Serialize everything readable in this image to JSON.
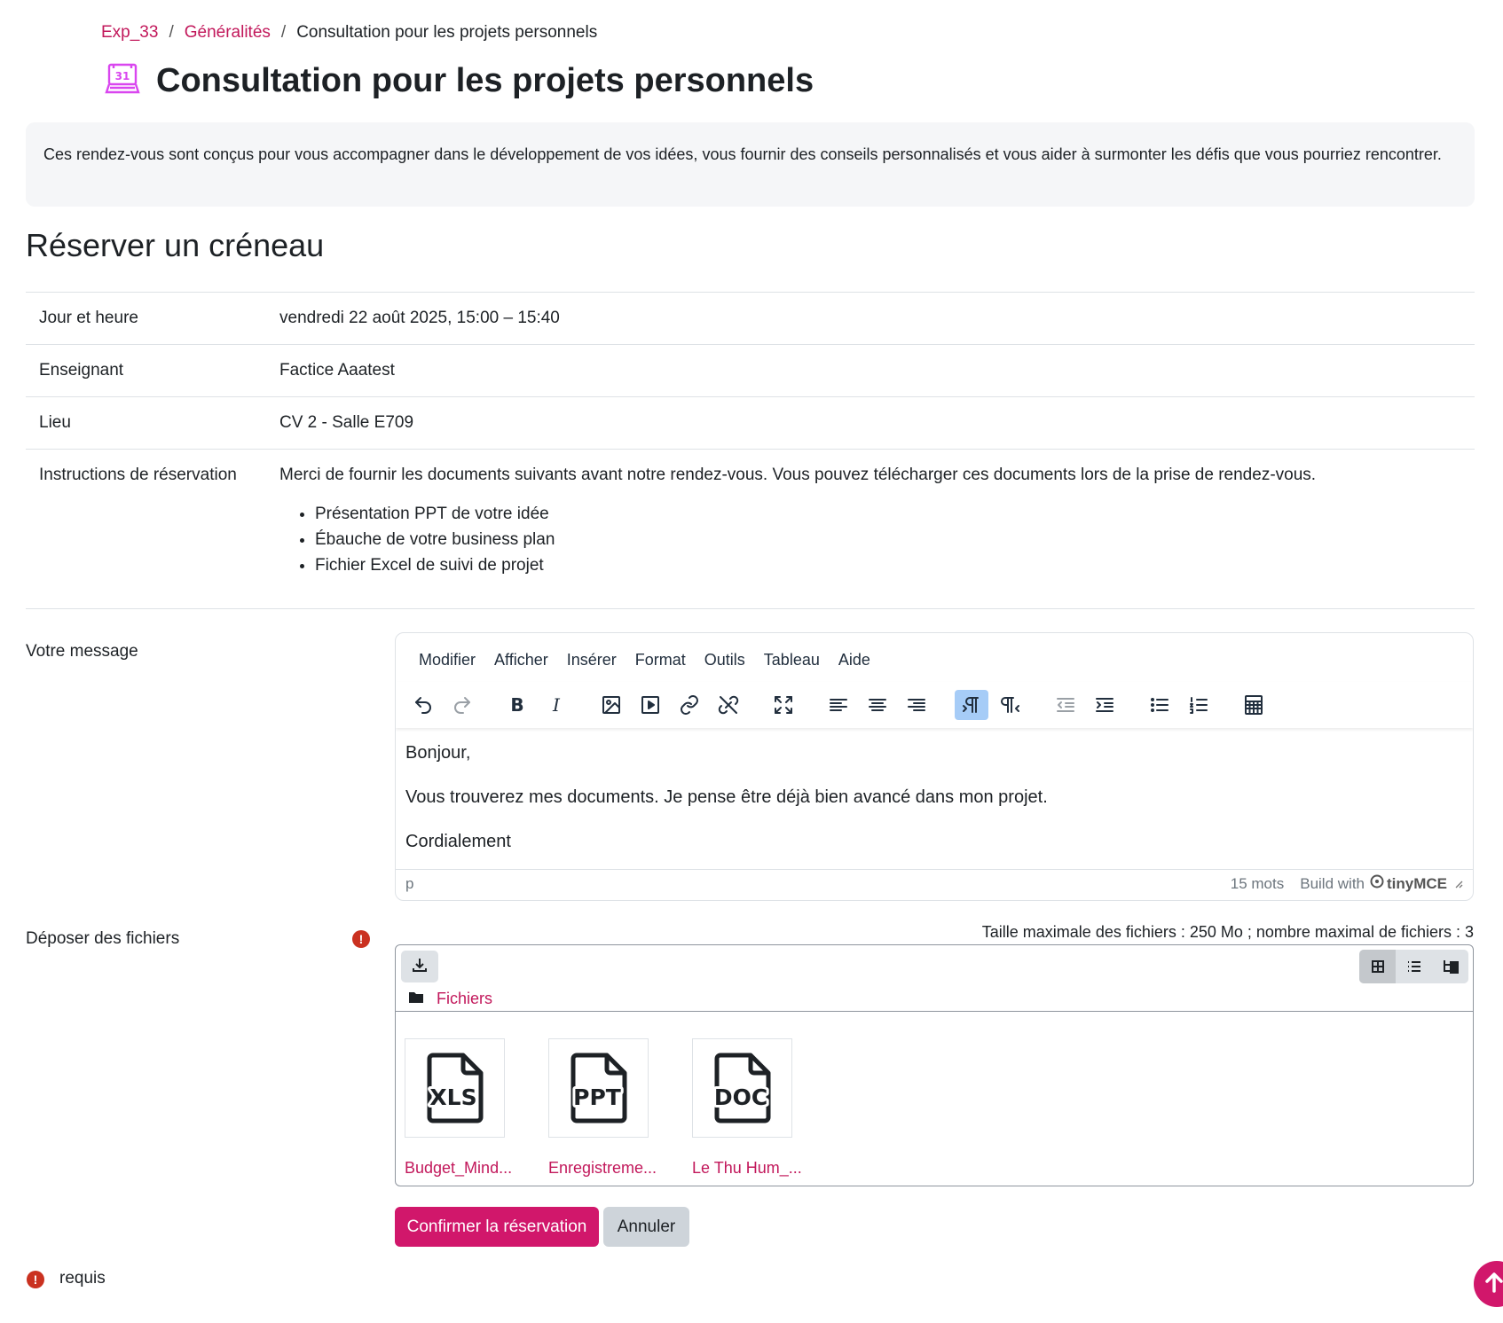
{
  "breadcrumb": {
    "items": [
      "Exp_33",
      "Généralités",
      "Consultation pour les projets personnels"
    ],
    "separator": "/"
  },
  "page": {
    "title": "Consultation pour les projets personnels",
    "intro": "Ces rendez-vous sont conçus pour vous accompagner dans le développement de vos idées, vous fournir des conseils personnalisés et vous aider à surmonter les défis que vous pourriez rencontrer.",
    "section_title": "Réserver un créneau",
    "icon": "calendar-31-icon",
    "accent_color": "#d1176b",
    "icon_color": "#d946ef"
  },
  "details": {
    "date_label": "Jour et heure",
    "date_value": "vendredi 22 août 2025, 15:00 – 15:40",
    "teacher_label": "Enseignant",
    "teacher_value": "Factice Aaatest",
    "location_label": "Lieu",
    "location_value": "CV 2 - Salle E709",
    "instructions_label": "Instructions de réservation",
    "instructions_text": "Merci de fournir les documents suivants avant notre rendez-vous. Vous pouvez télécharger ces documents lors de la prise de rendez-vous.",
    "instructions_items": [
      "Présentation PPT de votre idée",
      "Ébauche de votre business plan",
      "Fichier Excel de suivi de projet"
    ]
  },
  "message": {
    "label": "Votre message",
    "menu": [
      "Modifier",
      "Afficher",
      "Insérer",
      "Format",
      "Outils",
      "Tableau",
      "Aide"
    ],
    "toolbar": [
      "undo-icon",
      "redo-icon",
      "bold-icon",
      "italic-icon",
      "image-icon",
      "media-icon",
      "link-icon",
      "unlink-icon",
      "fullscreen-icon",
      "align-left-icon",
      "align-center-icon",
      "align-right-icon",
      "ltr-icon",
      "rtl-icon",
      "outdent-icon",
      "indent-icon",
      "bullet-list-icon",
      "numbered-list-icon",
      "calculator-icon"
    ],
    "bold_glyph": "B",
    "italic_glyph": "I",
    "content": [
      "Bonjour,",
      "Vous trouverez mes documents. Je pense être déjà bien avancé dans mon projet.",
      "Cordialement"
    ],
    "status_path": "p",
    "word_count": "15 mots",
    "build_with": "Build with",
    "brand": "tinyMCE"
  },
  "files": {
    "label": "Déposer des fichiers",
    "limits": "Taille maximale des fichiers : 250 Mo ; nombre maximal de fichiers : 3",
    "folder": "Fichiers",
    "items": [
      {
        "type": "XLS",
        "name": "Budget_Mind..."
      },
      {
        "type": "PPT",
        "name": "Enregistreme..."
      },
      {
        "type": "DOC",
        "name": "Le Thu Hum_..."
      }
    ]
  },
  "actions": {
    "confirm": "Confirmer la réservation",
    "cancel": "Annuler"
  },
  "required": {
    "glyph": "!",
    "label": "requis"
  }
}
